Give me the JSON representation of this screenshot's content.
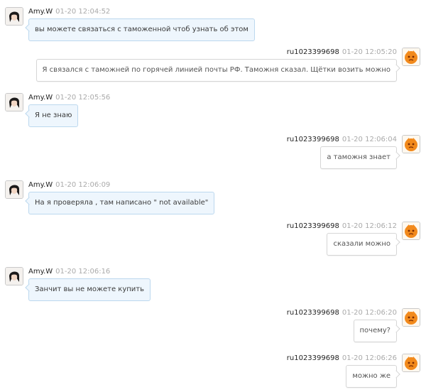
{
  "messages": [
    {
      "side": "left",
      "name": "Amy.W",
      "time": "01-20 12:04:52",
      "text": "вы можете связаться с таможенной чтоб узнать об этом",
      "avatar": "user-avatar-icon"
    },
    {
      "side": "right",
      "name": "ru1023399698",
      "time": "01-20 12:05:20",
      "text": "Я связался с таможней по горячей линией почты РФ. Таможня сказал. Щётки возить можно",
      "avatar": "orange-mascot-avatar-icon"
    },
    {
      "side": "left",
      "name": "Amy.W",
      "time": "01-20 12:05:56",
      "text": "Я не знаю",
      "avatar": "user-avatar-icon"
    },
    {
      "side": "right",
      "name": "ru1023399698",
      "time": "01-20 12:06:04",
      "text": "а таможня знает",
      "avatar": "orange-mascot-avatar-icon"
    },
    {
      "side": "left",
      "name": "Amy.W",
      "time": "01-20 12:06:09",
      "text": "На я проверяла , там написано  \" not available\"",
      "avatar": "user-avatar-icon"
    },
    {
      "side": "right",
      "name": "ru1023399698",
      "time": "01-20 12:06:12",
      "text": "сказали можно",
      "avatar": "orange-mascot-avatar-icon"
    },
    {
      "side": "left",
      "name": "Amy.W",
      "time": "01-20 12:06:16",
      "text": "Занчит вы не можете купить",
      "avatar": "user-avatar-icon"
    },
    {
      "side": "right",
      "name": "ru1023399698",
      "time": "01-20 12:06:20",
      "text": "почему?",
      "avatar": "orange-mascot-avatar-icon"
    },
    {
      "side": "right",
      "name": "ru1023399698",
      "time": "01-20 12:06:26",
      "text": "можно же",
      "avatar": "orange-mascot-avatar-icon"
    }
  ]
}
